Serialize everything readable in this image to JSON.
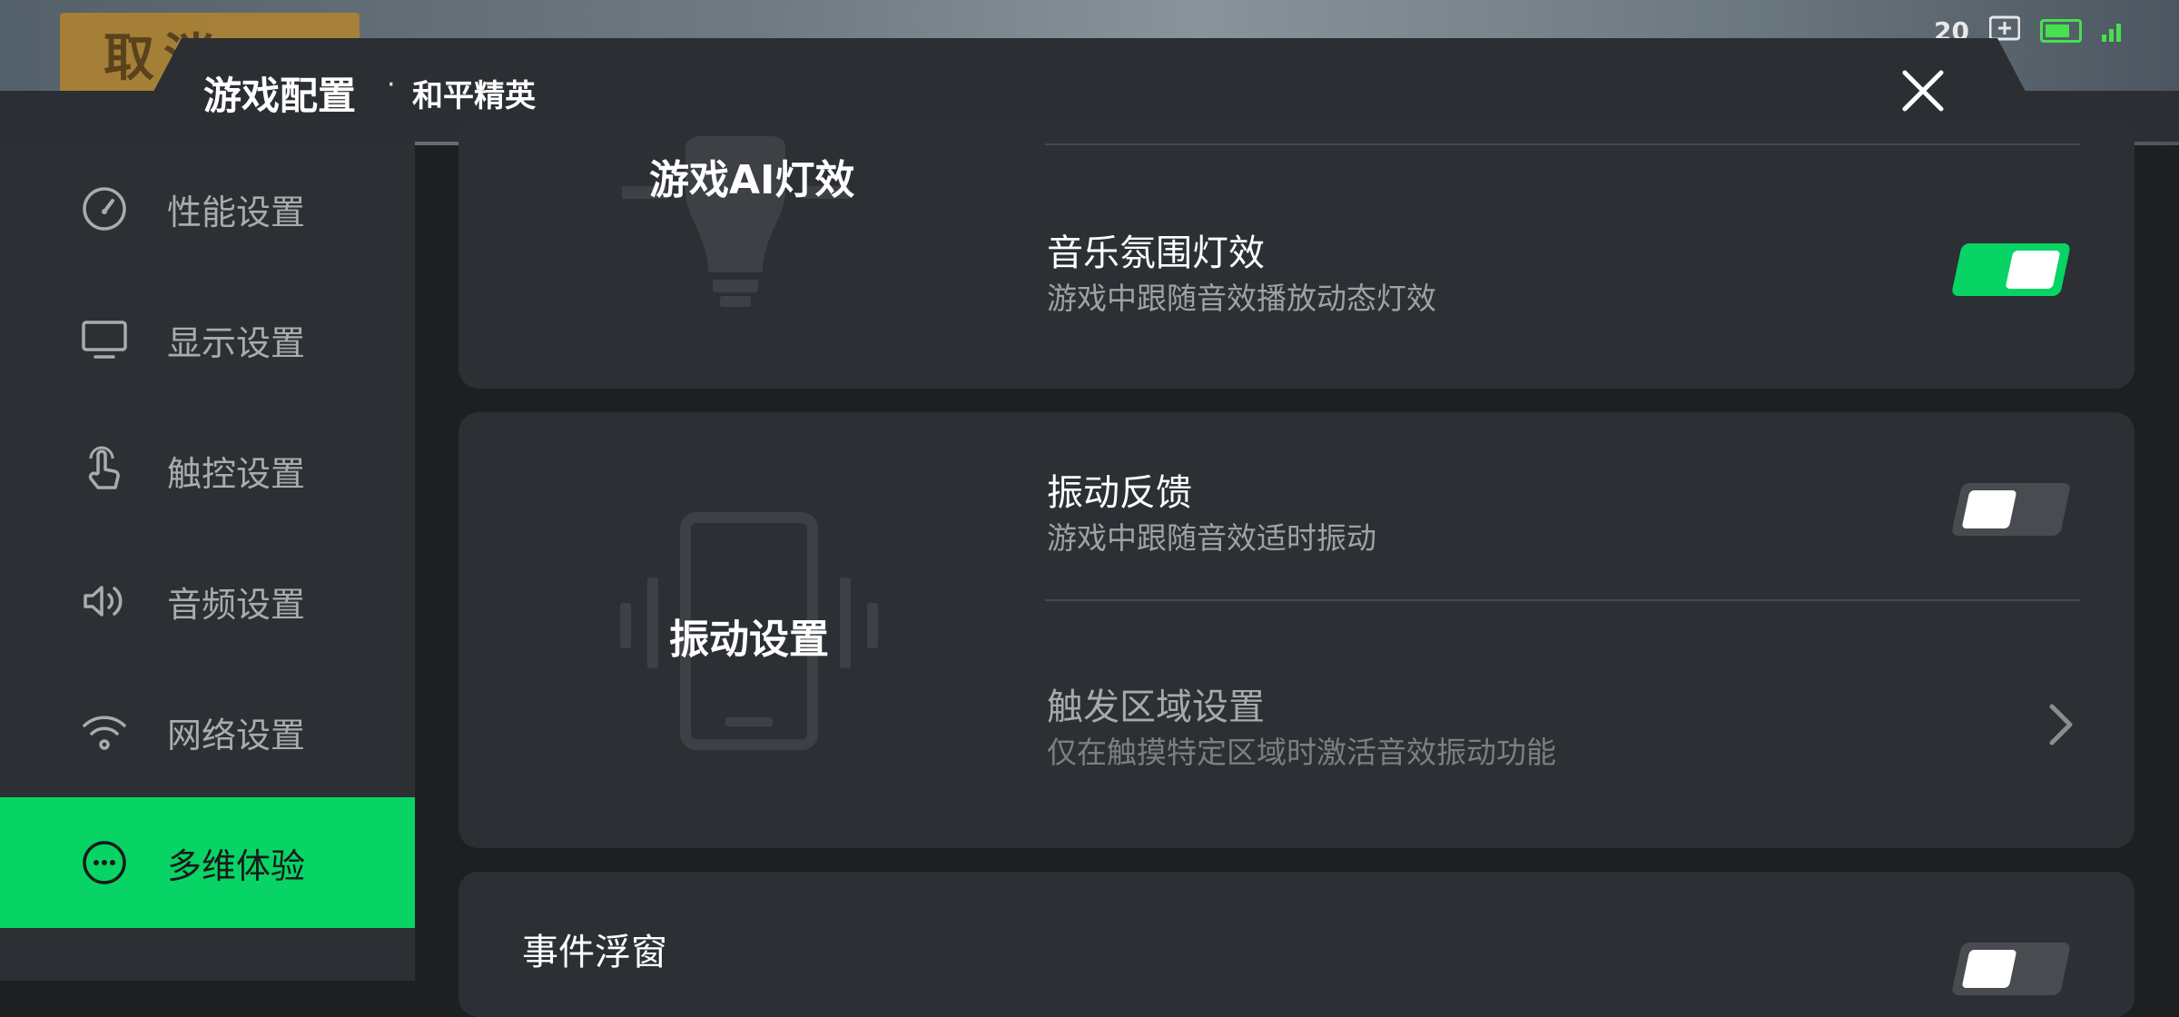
{
  "game_overlay": {
    "banner_text": "取消",
    "status_number": "20"
  },
  "header": {
    "title": "游戏配置",
    "separator": "·",
    "game_name": "和平精英"
  },
  "sidebar": {
    "items": [
      {
        "label": "性能设置",
        "icon": "gauge-icon"
      },
      {
        "label": "显示设置",
        "icon": "monitor-icon"
      },
      {
        "label": "触控设置",
        "icon": "touch-icon"
      },
      {
        "label": "音频设置",
        "icon": "speaker-icon"
      },
      {
        "label": "网络设置",
        "icon": "wifi-icon"
      },
      {
        "label": "多维体验",
        "icon": "more-dots-icon",
        "active": true
      }
    ]
  },
  "lighting_card": {
    "feature_label": "游戏AI灯效",
    "rows": [
      {
        "title": "音乐氛围灯效",
        "desc": "游戏中跟随音效播放动态灯效",
        "toggle": "on"
      }
    ]
  },
  "vibration_card": {
    "feature_label": "振动设置",
    "rows": [
      {
        "title": "振动反馈",
        "desc": "游戏中跟随音效适时振动",
        "toggle": "off"
      },
      {
        "title": "触发区域设置",
        "desc": "仅在触摸特定区域时激活音效振动功能",
        "type": "link"
      }
    ]
  },
  "event_card": {
    "rows": [
      {
        "title": "事件浮窗",
        "toggle": "off"
      }
    ]
  },
  "colors": {
    "accent": "#07d465",
    "panel": "#2c3034",
    "background": "#1d1f21"
  }
}
